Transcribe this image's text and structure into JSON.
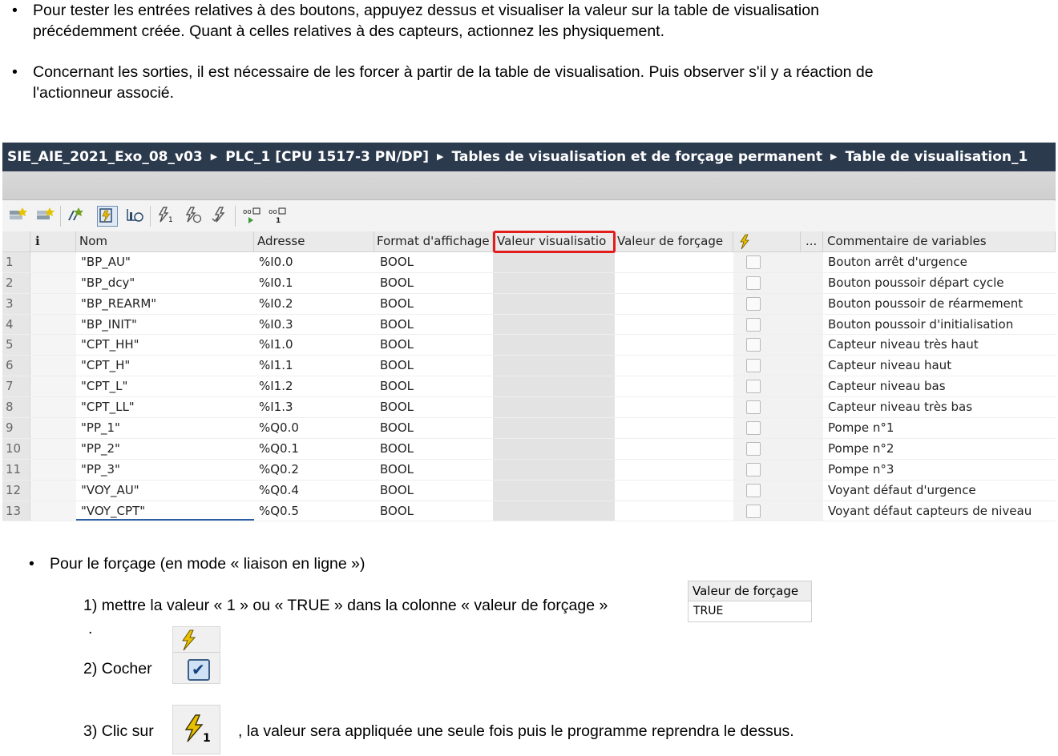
{
  "intro": {
    "p1_line1": "Pour tester les entrées relatives à des boutons, appuyez dessus et visualiser la valeur sur la table de visualisation",
    "p1_line2": "précédemment créée. Quant à celles relatives à des capteurs, actionnez les physiquement.",
    "p2_line1": "Concernant les sorties, il est nécessaire de les forcer à partir de la table de visualisation. Puis observer s'il y a réaction de",
    "p2_line2": "l'actionneur associé.",
    "bullet": "•"
  },
  "breadcrumb": [
    "SIE_AIE_2021_Exo_08_v03",
    "PLC_1 [CPU 1517-3 PN/DP]",
    "Tables de visualisation et de forçage permanent",
    "Table de visualisation_1"
  ],
  "breadcrumb_sep": "▶",
  "table": {
    "headers": {
      "info": "i",
      "nom": "Nom",
      "adresse": "Adresse",
      "format": "Format d'affichage",
      "valeur_vis": "Valeur visualisatio",
      "valeur_forcage": "Valeur de forçage",
      "ellipsis": "...",
      "commentaire": "Commentaire de variables"
    },
    "rows": [
      {
        "n": "1",
        "nom": "\"BP_AU\"",
        "adresse": "%I0.0",
        "format": "BOOL",
        "comment": "Bouton arrêt d'urgence"
      },
      {
        "n": "2",
        "nom": "\"BP_dcy\"",
        "adresse": "%I0.1",
        "format": "BOOL",
        "comment": "Bouton poussoir départ cycle"
      },
      {
        "n": "3",
        "nom": "\"BP_REARM\"",
        "adresse": "%I0.2",
        "format": "BOOL",
        "comment": "Bouton poussoir de réarmement"
      },
      {
        "n": "4",
        "nom": "\"BP_INIT\"",
        "adresse": "%I0.3",
        "format": "BOOL",
        "comment": "Bouton poussoir d'initialisation"
      },
      {
        "n": "5",
        "nom": "\"CPT_HH\"",
        "adresse": "%I1.0",
        "format": "BOOL",
        "comment": "Capteur niveau très haut"
      },
      {
        "n": "6",
        "nom": "\"CPT_H\"",
        "adresse": "%I1.1",
        "format": "BOOL",
        "comment": "Capteur niveau haut"
      },
      {
        "n": "7",
        "nom": "\"CPT_L\"",
        "adresse": "%I1.2",
        "format": "BOOL",
        "comment": "Capteur niveau bas"
      },
      {
        "n": "8",
        "nom": "\"CPT_LL\"",
        "adresse": "%I1.3",
        "format": "BOOL",
        "comment": "Capteur niveau très bas"
      },
      {
        "n": "9",
        "nom": "\"PP_1\"",
        "adresse": "%Q0.0",
        "format": "BOOL",
        "comment": "Pompe n°1"
      },
      {
        "n": "10",
        "nom": "\"PP_2\"",
        "adresse": "%Q0.1",
        "format": "BOOL",
        "comment": "Pompe n°2"
      },
      {
        "n": "11",
        "nom": "\"PP_3\"",
        "adresse": "%Q0.2",
        "format": "BOOL",
        "comment": "Pompe n°3"
      },
      {
        "n": "12",
        "nom": "\"VOY_AU\"",
        "adresse": "%Q0.4",
        "format": "BOOL",
        "comment": "Voyant défaut d'urgence"
      },
      {
        "n": "13",
        "nom": "\"VOY_CPT\"",
        "adresse": "%Q0.5",
        "format": "BOOL",
        "comment": "Voyant défaut capteurs de niveau"
      }
    ]
  },
  "forcing": {
    "bullet": "•",
    "title": "Pour le forçage (en mode « liaison en ligne »)",
    "step1": "1)  mettre la valeur « 1  » ou « TRUE » dans la colonne « valeur de forçage »",
    "step1_dot": ".",
    "step2": "2)  Cocher",
    "step3_a": "3) Clic sur",
    "step3_b": ", la valeur sera appliquée une seule fois puis le programme reprendra le dessus.",
    "widget_header": "Valeur de forçage",
    "widget_value": "TRUE",
    "one_label": "1"
  },
  "colors": {
    "titlebar": "#2c3a4e",
    "highlight": "#e31c1c"
  }
}
